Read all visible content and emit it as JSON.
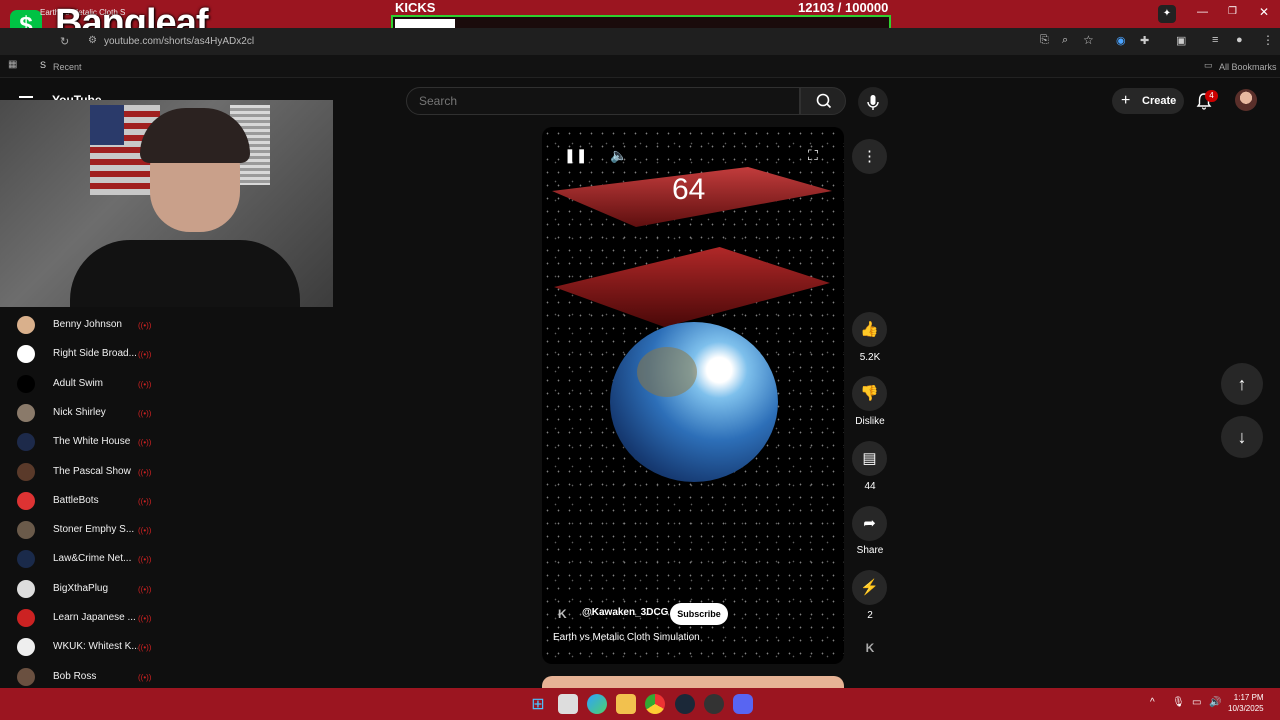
{
  "overlay": {
    "brand": "Bangleaf",
    "dollar_symbol": "$",
    "kicks_label": "KICKS",
    "kicks_count": "12103  / 100000",
    "kicks_progress": 0.121
  },
  "browser": {
    "tab_title": "Earth vs Metalic Cloth S",
    "url": "youtube.com/shorts/as4HyADx2cl",
    "bookmarks": {
      "recent": "Recent",
      "all": "All Bookmarks"
    }
  },
  "youtube": {
    "logo_text": "YouTube",
    "search_placeholder": "Search",
    "create_label": "Create",
    "notification_count": "4"
  },
  "subscriptions": [
    {
      "name": "Benny Johnson",
      "color": "#d9b08c"
    },
    {
      "name": "Right Side Broad...",
      "color": "#ffffff"
    },
    {
      "name": "Adult Swim",
      "color": "#000000"
    },
    {
      "name": "Nick Shirley",
      "color": "#8a7a6a"
    },
    {
      "name": "The White House",
      "color": "#1d2a4a"
    },
    {
      "name": "The Pascal Show",
      "color": "#5a3a2a"
    },
    {
      "name": "BattleBots",
      "color": "#d33"
    },
    {
      "name": "Stoner Emphy S...",
      "color": "#6a5a4a"
    },
    {
      "name": "Law&Crime Net...",
      "color": "#1a2a4a"
    },
    {
      "name": "BigXthaPlug",
      "color": "#ddd"
    },
    {
      "name": "Learn Japanese ...",
      "color": "#cc2222"
    },
    {
      "name": "WKUK: Whitest K...",
      "color": "#eee"
    },
    {
      "name": "Bob Ross",
      "color": "#6a5040"
    }
  ],
  "short": {
    "overlay_number": "64",
    "channel": "@Kawaken_3DCG",
    "subscribe_label": "Subscribe",
    "title": "Earth vs Metalic Cloth Simulation"
  },
  "actions": {
    "likes": "5.2K",
    "dislike_label": "Dislike",
    "comments": "44",
    "share_label": "Share",
    "remix_count": "2"
  },
  "taskbar": {
    "time": "1:17 PM",
    "date": "10/3/2025"
  }
}
